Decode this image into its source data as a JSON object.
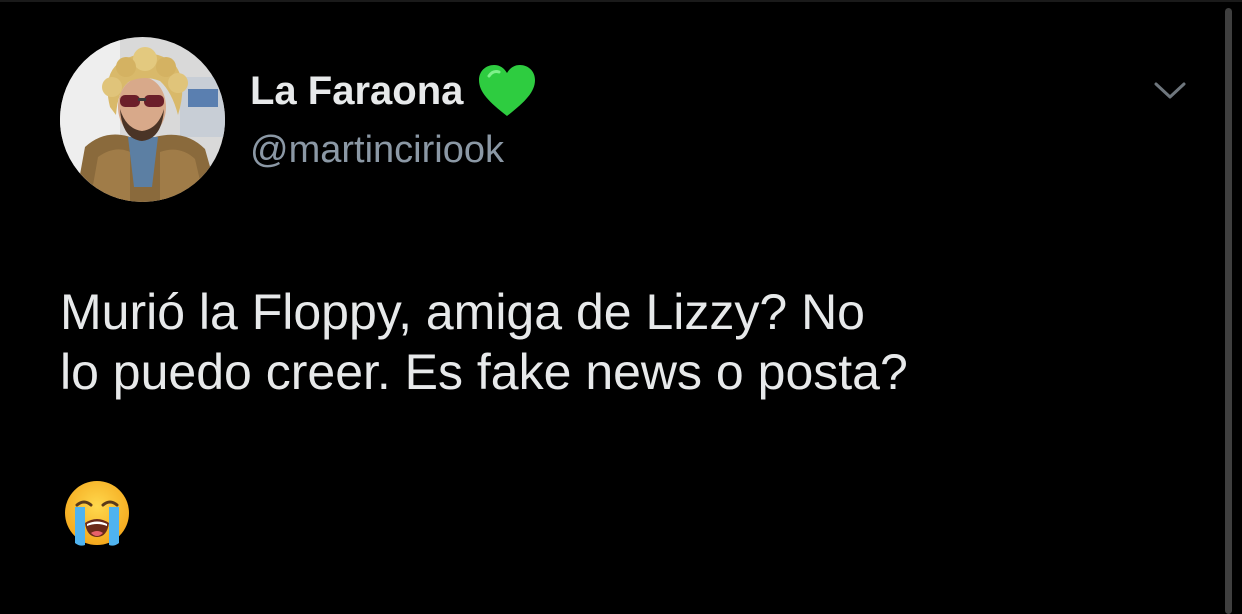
{
  "tweet": {
    "author": {
      "display_name": "La Faraona",
      "verified_icon": "green-heart-emoji",
      "handle": "@martinciriook"
    },
    "text_lines": [
      "Murió la Floppy, amiga de Lizzy? No",
      "lo puedo creer. Es fake news o posta?"
    ],
    "emoji": "loudly-crying-face-emoji",
    "menu_icon": "chevron-down-icon"
  },
  "colors": {
    "background": "#000000",
    "primary_text": "#e7e9ea",
    "secondary_text": "#8b98a5",
    "heart": "#2ecc40"
  }
}
